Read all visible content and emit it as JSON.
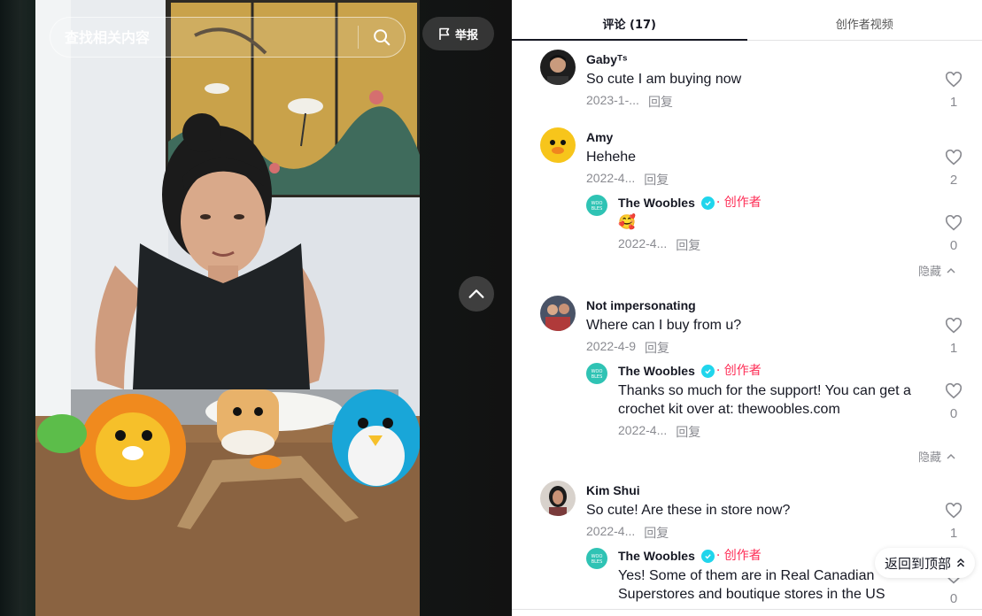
{
  "video": {
    "search_placeholder": "查找相关内容",
    "search_icon": "search-icon",
    "report_label": "举报",
    "report_icon": "flag-icon",
    "nav_up_icon": "chevron-up-icon"
  },
  "tabs": [
    {
      "label": "评论 (17)",
      "active": true
    },
    {
      "label": "创作者视频",
      "active": false
    }
  ],
  "comments": [
    {
      "user": "Gabyᵀˢ",
      "text": "So cute I am buying now",
      "date": "2023-1-...",
      "reply_label": "回复",
      "likes": "1"
    },
    {
      "user": "Amy",
      "text": "Hehehe",
      "date": "2022-4...",
      "reply_label": "回复",
      "likes": "2",
      "reply": {
        "user": "The Woobles",
        "creator_tag": "· 创作者",
        "text": "🥰",
        "date": "2022-4...",
        "reply_label": "回复",
        "likes": "0"
      },
      "collapse_label": "隐藏"
    },
    {
      "user": "Not impersonating",
      "text": "Where can I buy from u?",
      "date": "2022-4-9",
      "reply_label": "回复",
      "likes": "1",
      "reply": {
        "user": "The Woobles",
        "creator_tag": "· 创作者",
        "text": "Thanks so much for the support! You can get a crochet kit over at: thewoobles.com",
        "date": "2022-4...",
        "reply_label": "回复",
        "likes": "0"
      },
      "collapse_label": "隐藏"
    },
    {
      "user": "Kim Shui",
      "text": "So cute! Are these in store now?",
      "date": "2022-4...",
      "reply_label": "回复",
      "likes": "1",
      "reply": {
        "user": "The Woobles",
        "creator_tag": "· 创作者",
        "text": "Yes! Some of them are in Real Canadian Superstores and boutique stores in the US",
        "date": "",
        "reply_label": "",
        "likes": "0"
      }
    }
  ],
  "back_to_top_label": "返回到顶部",
  "colors": {
    "accent": "#fe2c55",
    "verified": "#20d5ec",
    "muted": "#8a8b91",
    "text": "#161823"
  }
}
